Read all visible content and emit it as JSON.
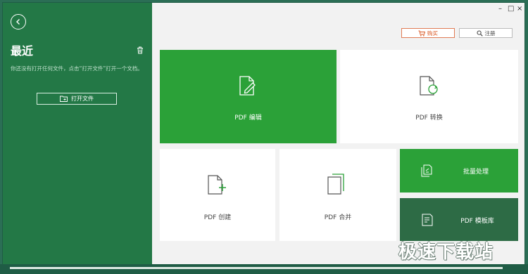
{
  "sidebar": {
    "title": "最近",
    "empty_hint": "你还没有打开任何文件，点击“打开文件”打开一个文档。",
    "open_button": "打开文件"
  },
  "titlebar": {
    "minimize": "–",
    "maximize": "□",
    "close": "×"
  },
  "header": {
    "buy_label": "购买",
    "register_label": "注册"
  },
  "tiles": {
    "edit": "PDF 编辑",
    "convert": "PDF 转换",
    "create": "PDF 创建",
    "merge": "PDF 合并",
    "batch": "批量处理",
    "template": "PDF 模板库"
  },
  "watermark": "极速下载站",
  "colors": {
    "sidebar": "#237846",
    "tile_green": "#2ba138",
    "tile_dark": "#2d6b45",
    "buy_accent": "#d9541e"
  }
}
